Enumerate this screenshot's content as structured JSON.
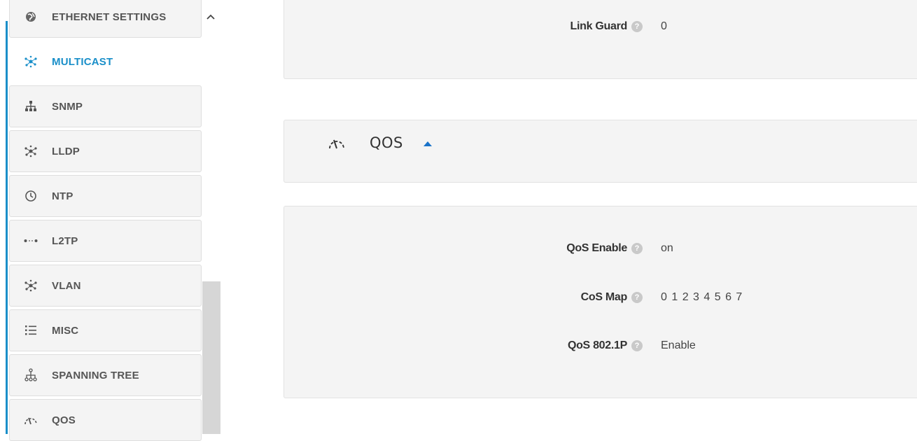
{
  "sidebar": {
    "items": [
      {
        "label": "ETHERNET SETTINGS",
        "icon": "globe-icon",
        "active": false
      },
      {
        "label": "MULTICAST",
        "icon": "network-hub-icon",
        "active": true
      },
      {
        "label": "SNMP",
        "icon": "sitemap-icon",
        "active": false
      },
      {
        "label": "LLDP",
        "icon": "network-hub-icon",
        "active": false
      },
      {
        "label": "NTP",
        "icon": "clock-icon",
        "active": false
      },
      {
        "label": "L2TP",
        "icon": "dotted-link-icon",
        "active": false
      },
      {
        "label": "VLAN",
        "icon": "network-hub-icon",
        "active": false
      },
      {
        "label": "MISC",
        "icon": "list-icon",
        "active": false
      },
      {
        "label": "SPANNING TREE",
        "icon": "tree-icon",
        "active": false
      },
      {
        "label": "QOS",
        "icon": "gauge-icon",
        "active": false
      }
    ],
    "accent_color": "#1a8fc9"
  },
  "main": {
    "link_guard": {
      "label": "Link Guard",
      "value": "0"
    },
    "qos_section": {
      "title": "QOS",
      "expanded": true
    },
    "qos_fields": [
      {
        "label": "QoS Enable",
        "value": "on"
      },
      {
        "label": "CoS Map",
        "value": "0 1 2 3 4 5 6 7"
      },
      {
        "label": "QoS 802.1P",
        "value": "Enable"
      }
    ]
  }
}
